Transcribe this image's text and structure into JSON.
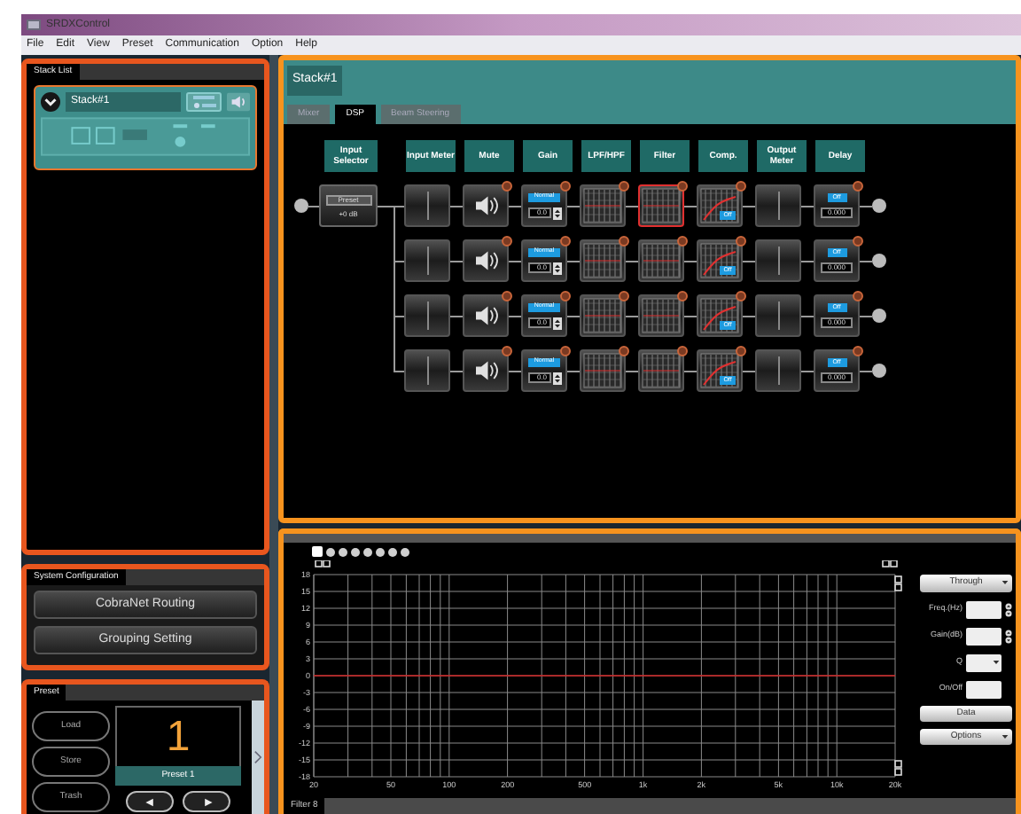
{
  "window": {
    "title": "SRDXControl"
  },
  "menu": [
    "File",
    "Edit",
    "View",
    "Preset",
    "Communication",
    "Option",
    "Help"
  ],
  "stack_list": {
    "tab": "Stack List",
    "stacks": [
      {
        "name": "Stack#1",
        "expanded": true
      }
    ]
  },
  "system_configuration": {
    "tab": "System Configuration",
    "buttons": [
      "CobraNet Routing",
      "Grouping Setting"
    ]
  },
  "preset": {
    "tab": "Preset",
    "buttons": [
      "Load",
      "Store",
      "Trash"
    ],
    "number": "1",
    "name": "Preset 1"
  },
  "dsp": {
    "stack_title": "Stack#1",
    "tabs": [
      {
        "label": "Mixer",
        "selected": false
      },
      {
        "label": "DSP",
        "selected": true
      },
      {
        "label": "Beam Steering",
        "selected": false
      }
    ],
    "columns": [
      "Input Selector",
      "Input Meter",
      "Mute",
      "Gain",
      "LPF/HPF",
      "Filter",
      "Comp.",
      "Output Meter",
      "Delay"
    ],
    "input": {
      "label": "Preset",
      "value": "+0 dB"
    },
    "channels": [
      {
        "gain_mode": "Normal",
        "gain": "0.0",
        "filter_selected": true,
        "comp_state": "Off",
        "delay_state": "Off",
        "delay": "0.000"
      },
      {
        "gain_mode": "Normal",
        "gain": "0.0",
        "filter_selected": false,
        "comp_state": "Off",
        "delay_state": "Off",
        "delay": "0.000"
      },
      {
        "gain_mode": "Normal",
        "gain": "0.0",
        "filter_selected": false,
        "comp_state": "Off",
        "delay_state": "Off",
        "delay": "0.000"
      },
      {
        "gain_mode": "Normal",
        "gain": "0.0",
        "filter_selected": false,
        "comp_state": "Off",
        "delay_state": "Off",
        "delay": "0.000"
      }
    ]
  },
  "filter_editor": {
    "tab": "Filter 8",
    "bands": [
      {
        "selected": true
      },
      {
        "selected": false
      },
      {
        "selected": false
      },
      {
        "selected": false
      },
      {
        "selected": false
      },
      {
        "selected": false
      },
      {
        "selected": false
      },
      {
        "selected": false
      }
    ],
    "type": "Through",
    "fields": [
      {
        "label": "Freq.(Hz)",
        "kind": "spin"
      },
      {
        "label": "Gain(dB)",
        "kind": "spin"
      },
      {
        "label": "Q",
        "kind": "dropdown"
      },
      {
        "label": "On/Off",
        "kind": "plain"
      }
    ],
    "buttons": [
      {
        "label": "Data",
        "kind": "button"
      },
      {
        "label": "Options",
        "kind": "dropdown"
      }
    ],
    "graph": {
      "x_labels": [
        "20",
        "50",
        "100",
        "200",
        "500",
        "1k",
        "2k",
        "5k",
        "10k",
        "20k"
      ],
      "y_labels": [
        "18",
        "15",
        "12",
        "9",
        "6",
        "3",
        "0",
        "-3",
        "-6",
        "-9",
        "-12",
        "-15",
        "-18"
      ]
    }
  }
}
